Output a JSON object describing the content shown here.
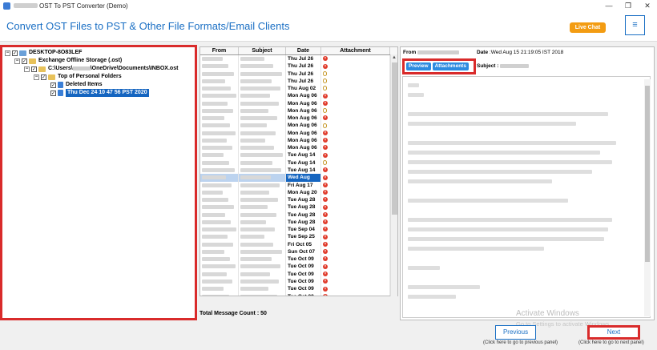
{
  "window": {
    "title": "OST To PST Converter (Demo)",
    "buttons": [
      "—",
      "❐",
      "✕"
    ]
  },
  "header": {
    "heading": "Convert OST Files to PST & Other File Formats/Email Clients",
    "live_chat": "Live Chat",
    "menu_icon": "hamburger-icon"
  },
  "tree": {
    "root": "DESKTOP-8O83LEF",
    "store": "Exchange Offline Storage (.ost)",
    "path_prefix": "C:\\Users\\",
    "path_suffix": "\\OneDrive\\Documents\\INBOX.ost",
    "top": "Top of Personal Folders",
    "deleted": "Deleted Items",
    "selected": "Thu Dec 24 10 47 56 PST 2020"
  },
  "grid": {
    "columns": {
      "from": "From",
      "subject": "Subject",
      "date": "Date",
      "attachment": "Attachment"
    },
    "rows": [
      {
        "date": "Thu Jul 26",
        "att": "x"
      },
      {
        "date": "Thu Jul 26",
        "att": "x"
      },
      {
        "date": "Thu Jul 26",
        "att": "clip"
      },
      {
        "date": "Thu Jul 26",
        "att": "clip"
      },
      {
        "date": "Thu Aug 02",
        "att": "clip"
      },
      {
        "date": "Mon Aug 06",
        "att": "x"
      },
      {
        "date": "Mon Aug 06",
        "att": "x"
      },
      {
        "date": "Mon Aug 06",
        "att": "clip"
      },
      {
        "date": "Mon Aug 06",
        "att": "x"
      },
      {
        "date": "Mon Aug 06",
        "att": "clip"
      },
      {
        "date": "Mon Aug 06",
        "att": "x"
      },
      {
        "date": "Mon Aug 06",
        "att": "x"
      },
      {
        "date": "Mon Aug 06",
        "att": "x"
      },
      {
        "date": "Tue Aug 14",
        "att": "x"
      },
      {
        "date": "Tue Aug 14",
        "att": "clip"
      },
      {
        "date": "Tue Aug 14",
        "att": "x"
      },
      {
        "date": "Wed Aug",
        "att": "x",
        "selected": true
      },
      {
        "date": "Fri Aug 17",
        "att": "x"
      },
      {
        "date": "Mon Aug 20",
        "att": "x"
      },
      {
        "date": "Tue Aug 28",
        "att": "x"
      },
      {
        "date": "Tue Aug 28",
        "att": "x"
      },
      {
        "date": "Tue Aug 28",
        "att": "x"
      },
      {
        "date": "Tue Aug 28",
        "att": "x"
      },
      {
        "date": "Tue Sep 04",
        "att": "x"
      },
      {
        "date": "Tue Sep 25",
        "att": "x"
      },
      {
        "date": "Fri Oct 05",
        "att": "x"
      },
      {
        "date": "Sun Oct 07",
        "att": "x"
      },
      {
        "date": "Tue Oct 09",
        "att": "x"
      },
      {
        "date": "Tue Oct 09",
        "att": "x"
      },
      {
        "date": "Tue Oct 09",
        "att": "x"
      },
      {
        "date": "Tue Oct 09",
        "att": "x"
      },
      {
        "date": "Tue Oct 09",
        "att": "x"
      },
      {
        "date": "Tue Oct 09",
        "att": "x"
      }
    ],
    "count_label": "Total Message Count : 50"
  },
  "preview": {
    "from_label": "From",
    "date_label": "Date",
    "date_value": ":Wed Aug 15 21:19:05 IST 2018",
    "subject_label": "Subject :",
    "tab_preview": "Preview",
    "tab_attachments": "Attachments"
  },
  "watermark": {
    "line1": "Activate Windows",
    "line2": "Go to Settings to activate Windows."
  },
  "nav": {
    "previous": "Previous",
    "next": "Next",
    "hint_previous": "(Click here to go to previous panel)",
    "hint_next": "(Click here to go to next panel)"
  },
  "colors": {
    "accent": "#1a6fc4",
    "highlight": "#d92b2b",
    "live_chat": "#f39c12",
    "selection": "#1565c0"
  }
}
